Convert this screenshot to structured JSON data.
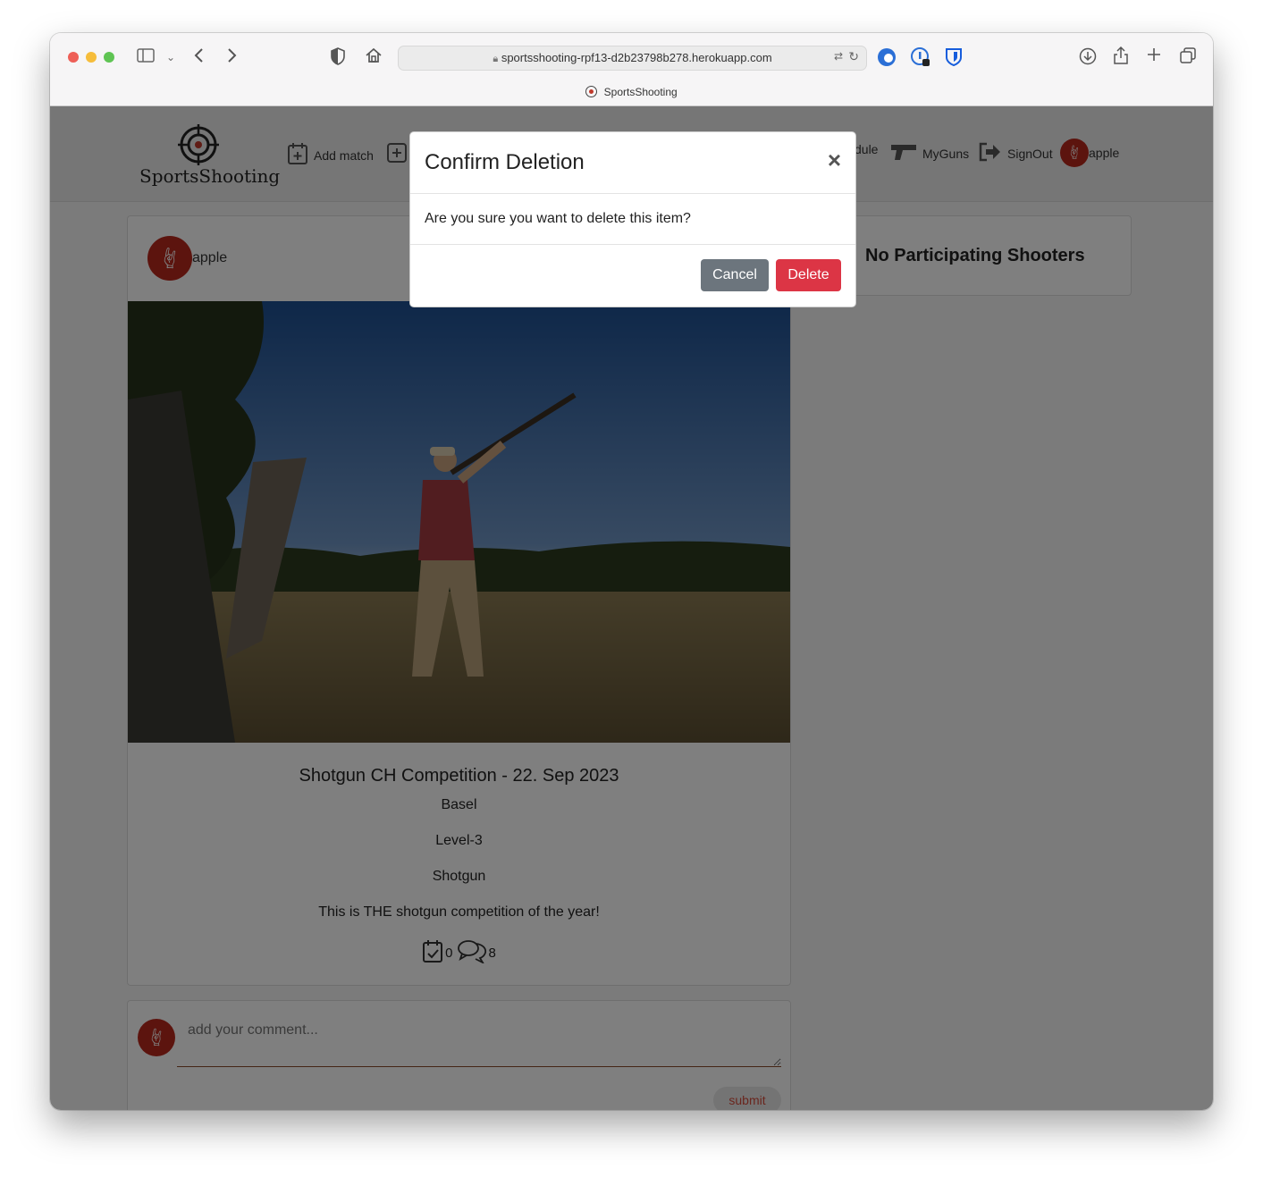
{
  "browser": {
    "url": "sportsshooting-rpf13-d2b23798b278.herokuapp.com",
    "tab_title": "SportsShooting"
  },
  "navbar": {
    "brand": "SportsShooting",
    "add_match": "Add match",
    "schedule_partial": "dule",
    "my_guns": "MyGuns",
    "sign_out": "SignOut",
    "username": "apple"
  },
  "post": {
    "author": "apple",
    "title": "Shotgun CH Competition - 22. Sep 2023",
    "location": "Basel",
    "level": "Level-3",
    "discipline": "Shotgun",
    "description": "This is THE shotgun competition of the year!",
    "participants_count": "0",
    "comments_count": "8"
  },
  "sidebar": {
    "participants_heading": "No Participating Shooters"
  },
  "comment_form": {
    "placeholder": "add your comment...",
    "submit_label": "submit"
  },
  "modal": {
    "title": "Confirm Deletion",
    "close_symbol": "×",
    "message": "Are you sure you want to delete this item?",
    "cancel_label": "Cancel",
    "delete_label": "Delete"
  },
  "colors": {
    "delete": "#dc3545",
    "cancel": "#6c757d",
    "avatar": "#b8281d",
    "accent": "#c0392b"
  }
}
